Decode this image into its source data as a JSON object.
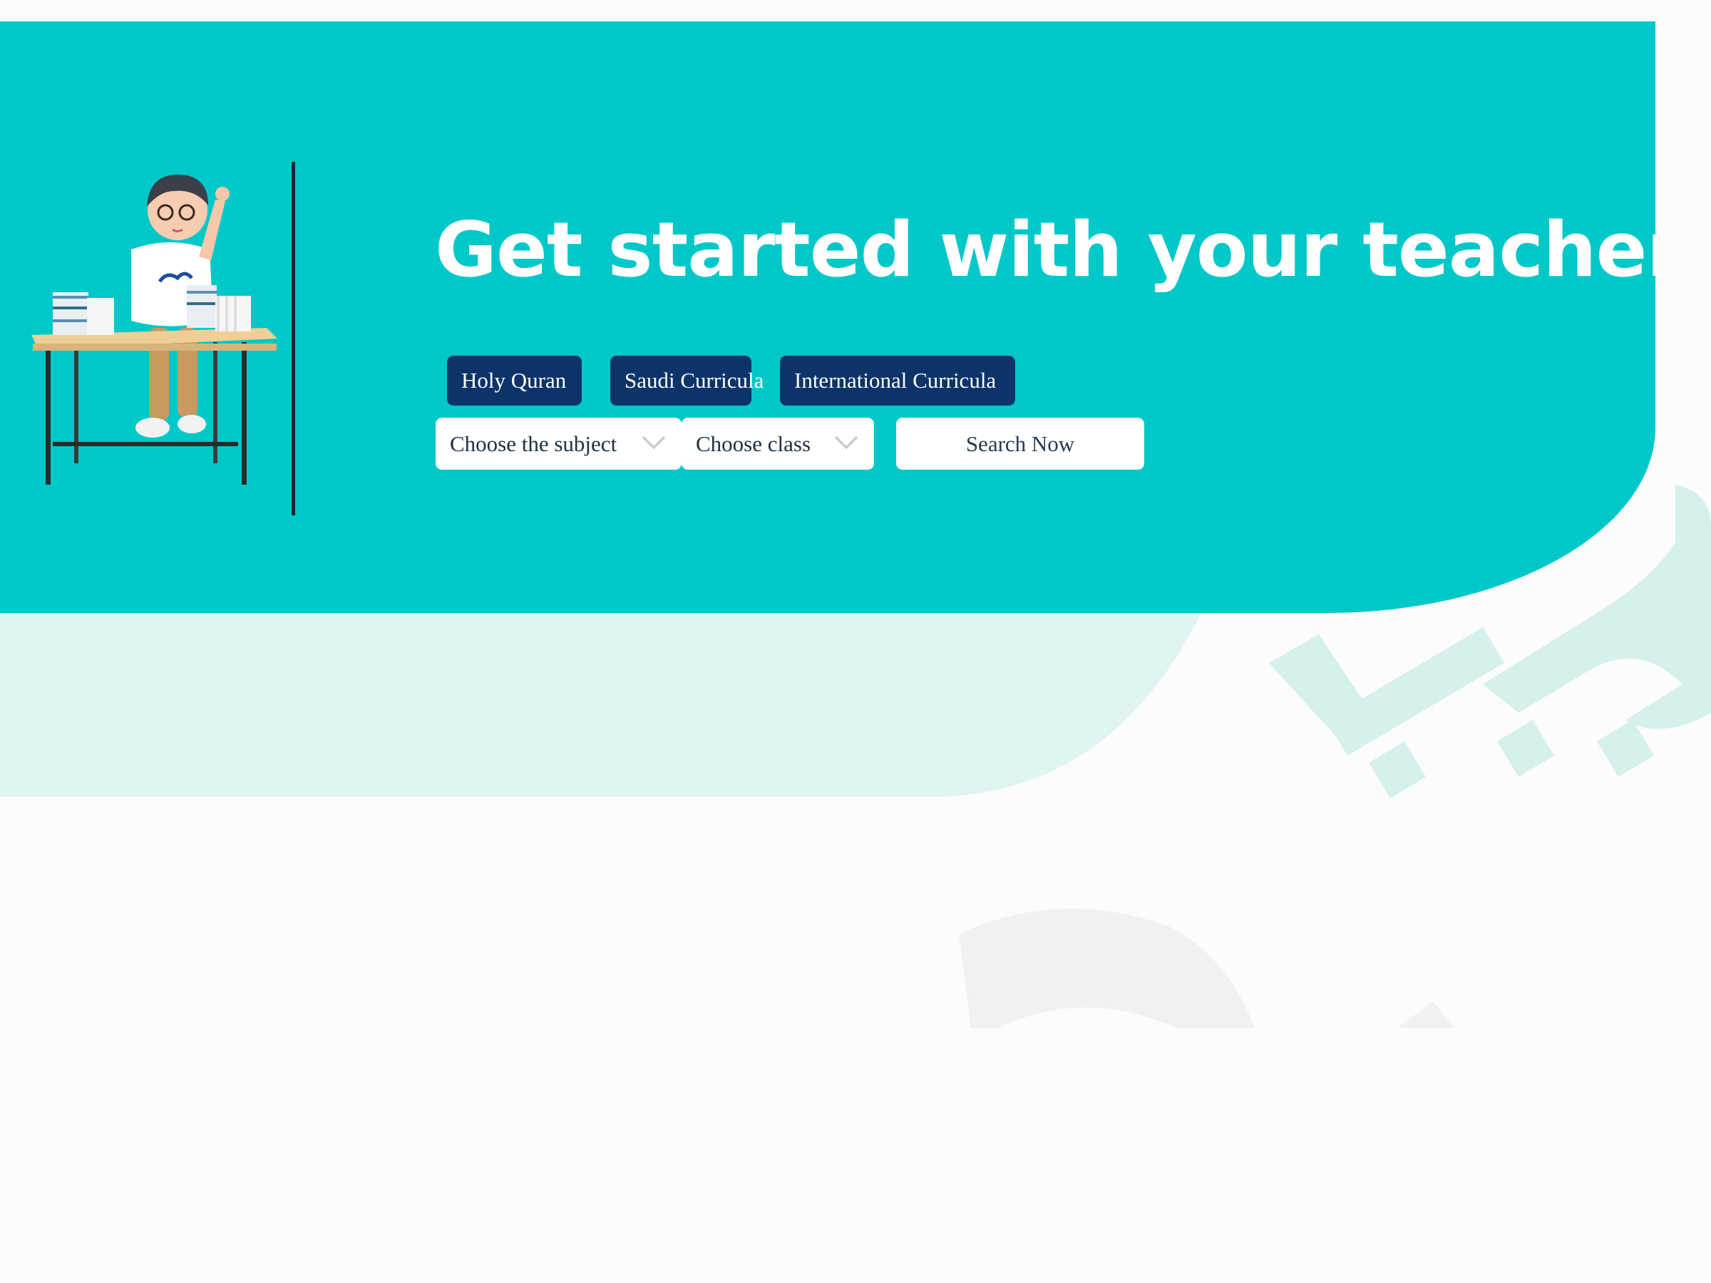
{
  "hero": {
    "heading": "Get started with your teacher",
    "background_color": "#00c8c8"
  },
  "categories": [
    {
      "label": "Holy Quran"
    },
    {
      "label": "Saudi Curricula"
    },
    {
      "label": "International Curricula"
    }
  ],
  "search": {
    "subject_select_value": "Choose the subject",
    "class_select_value": "Choose class",
    "button_label": "Search Now"
  },
  "colors": {
    "accent": "#00c8c8",
    "button_dark_blue": "#0d3468",
    "light_band": "#e0f4f1"
  },
  "icons": {
    "subject_dropdown": "chevron-down-icon",
    "class_dropdown": "chevron-down-icon"
  }
}
